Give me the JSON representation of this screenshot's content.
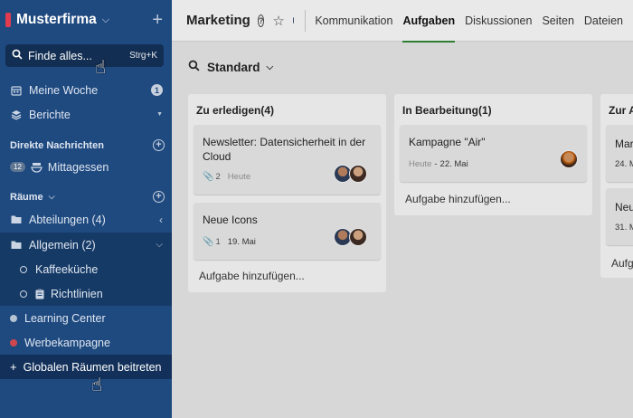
{
  "workspace": {
    "name": "Musterfirma"
  },
  "search": {
    "label": "Finde alles...",
    "shortcut": "Strg+K"
  },
  "nav": {
    "meine_woche": {
      "label": "Meine Woche",
      "badge": "1"
    },
    "berichte": {
      "label": "Berichte"
    }
  },
  "dm": {
    "heading": "Direkte Nachrichten",
    "items": [
      {
        "label": "Mittagessen",
        "count": "12"
      }
    ]
  },
  "rooms": {
    "heading": "Räume",
    "items": [
      {
        "label": "Abteilungen (4)"
      },
      {
        "label": "Allgemein (2)"
      },
      {
        "label": "Kaffeeküche"
      },
      {
        "label": "Richtlinien"
      },
      {
        "label": "Learning Center",
        "color": "#c7d0dc"
      },
      {
        "label": "Werbekampagne",
        "color": "#e04848"
      }
    ],
    "join": "Globalen Räumen beitreten"
  },
  "header": {
    "title": "Marketing",
    "help_icon": "?",
    "tabs": [
      "Kommunikation",
      "Aufgaben",
      "Diskussionen",
      "Seiten",
      "Dateien"
    ],
    "active_tab": "Aufgaben"
  },
  "view": {
    "label": "Standard"
  },
  "board": {
    "add_task": "Aufgabe hinzufügen...",
    "columns": [
      {
        "title": "Zu erledigen(4)",
        "cards": [
          {
            "title": "Newsletter: Datensicherheit in der Cloud",
            "attachments": "2",
            "date": "Heute"
          },
          {
            "title": "Neue Icons",
            "attachments": "1",
            "date": "19. Mai"
          }
        ]
      },
      {
        "title": "In Bearbeitung(1)",
        "cards": [
          {
            "title": "Kampagne \"Air\"",
            "date_prefix": "Heute",
            "date": "22. Mai"
          }
        ]
      },
      {
        "title": "Zur A",
        "cards": [
          {
            "title": "Mar",
            "date": "24. M"
          },
          {
            "title": "Neu",
            "date": "31. M"
          }
        ],
        "add_task": "Aufg"
      }
    ]
  }
}
